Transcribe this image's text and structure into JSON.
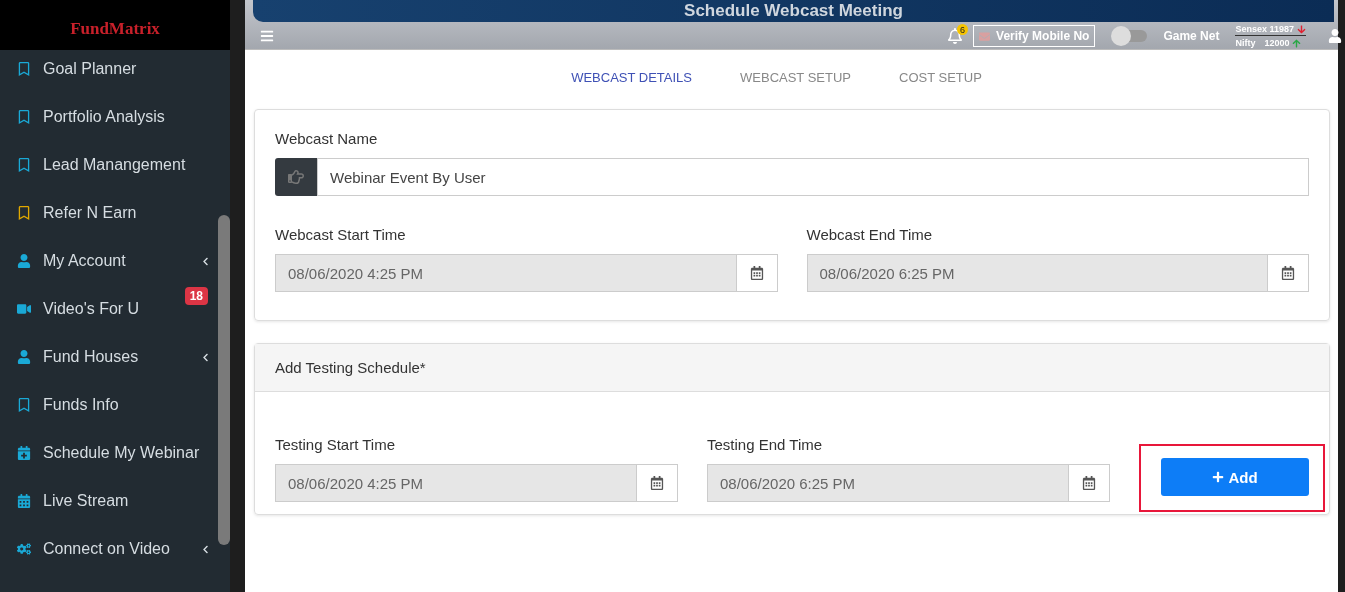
{
  "brand": "FundMatrix",
  "sidebar": {
    "items": [
      {
        "label": "Goal Planner",
        "kind": "bookmark",
        "color": "#1aa9d6",
        "arrow": false
      },
      {
        "label": "Portfolio Analysis",
        "kind": "bookmark",
        "color": "#1aa9d6",
        "arrow": false
      },
      {
        "label": "Lead Manangement",
        "kind": "bookmark",
        "color": "#1aa9d6",
        "arrow": false
      },
      {
        "label": "Refer N Earn",
        "kind": "bookmark",
        "color": "#e0a800",
        "arrow": false
      },
      {
        "label": "My Account",
        "kind": "user",
        "color": "#1aa9d6",
        "arrow": true
      },
      {
        "label": "Video's For U",
        "kind": "video",
        "color": "#1aa9d6",
        "arrow": false,
        "badge": "18"
      },
      {
        "label": "Fund Houses",
        "kind": "user",
        "color": "#1aa9d6",
        "arrow": true
      },
      {
        "label": "Funds Info",
        "kind": "bookmark",
        "color": "#1aa9d6",
        "arrow": false
      },
      {
        "label": "Schedule My Webinar",
        "kind": "schedule",
        "color": "#1aa9d6",
        "arrow": false
      },
      {
        "label": "Live Stream",
        "kind": "calendar",
        "color": "#1aa9d6",
        "arrow": false
      },
      {
        "label": "Connect on Video",
        "kind": "gears",
        "color": "#1aa9d6",
        "arrow": true
      }
    ]
  },
  "header": {
    "title": "Schedule Webcast Meeting",
    "notifications": "6",
    "verify": "Verify Mobile No",
    "toggle": {
      "label": "Game Net",
      "on": false
    },
    "sensex": {
      "label": "Sensex 11987",
      "up": false
    },
    "nifty": {
      "label": "Nifty",
      "value": "12000",
      "up": true
    }
  },
  "tabs": [
    {
      "label": "WEBCAST DETAILS",
      "selected": true
    },
    {
      "label": "WEBCAST SETUP",
      "selected": false
    },
    {
      "label": "COST SETUP",
      "selected": false
    }
  ],
  "details": {
    "name": {
      "label": "Webcast Name",
      "value": "Webinar Event By User"
    },
    "start": {
      "label": "Webcast Start Time",
      "value": "08/06/2020 4:25 PM",
      "disabled": true
    },
    "end": {
      "label": "Webcast End Time",
      "value": "08/06/2020 6:25 PM",
      "disabled": true
    }
  },
  "testing": {
    "title": "Add Testing Schedule*",
    "start": {
      "label": "Testing Start Time",
      "value": "08/06/2020 4:25 PM",
      "disabled": true
    },
    "end": {
      "label": "Testing End Time",
      "value": "08/06/2020 6:25 PM",
      "disabled": true
    },
    "add": "Add",
    "highlighted": true
  }
}
